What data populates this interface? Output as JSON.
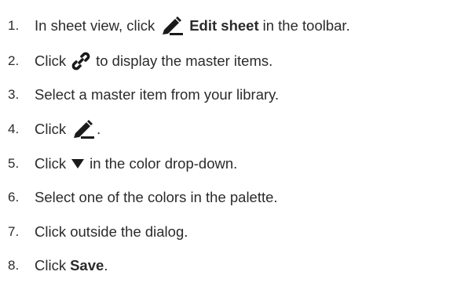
{
  "steps": [
    {
      "number": "1.",
      "before": "In sheet view, click",
      "icon": "pencil-icon",
      "bold": "Edit sheet",
      "after": "in the toolbar."
    },
    {
      "number": "2.",
      "before": "Click",
      "icon": "link-icon",
      "after": "to display the master items."
    },
    {
      "number": "3.",
      "before": "Select a master item from your library."
    },
    {
      "number": "4.",
      "before": "Click",
      "icon": "pencil-icon",
      "after": "."
    },
    {
      "number": "5.",
      "before": "Click",
      "icon": "triangle-down-icon",
      "after": "in the color drop-down."
    },
    {
      "number": "6.",
      "before": "Select one of the colors in the palette."
    },
    {
      "number": "7.",
      "before": "Click outside the dialog."
    },
    {
      "number": "8.",
      "before": "Click",
      "bold": "Save",
      "after": "."
    }
  ]
}
